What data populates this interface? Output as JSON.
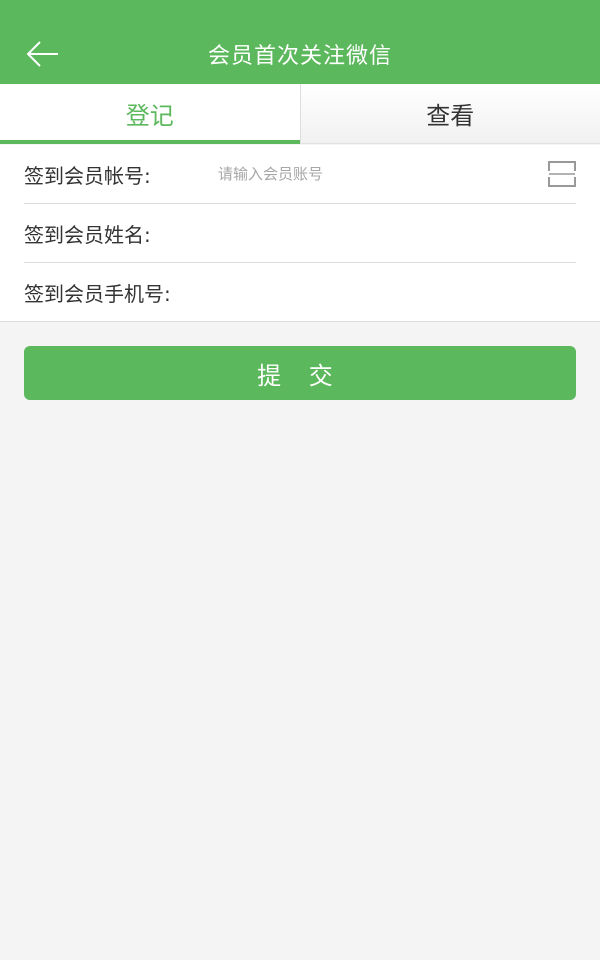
{
  "header": {
    "title": "会员首次关注微信",
    "back_icon": "arrow-left-icon"
  },
  "tabs": [
    {
      "label": "登记",
      "active": true
    },
    {
      "label": "查看",
      "active": false
    }
  ],
  "form": {
    "account": {
      "label": "签到会员帐号:",
      "placeholder": "请输入会员账号",
      "value": "",
      "scan_icon": "scan-icon"
    },
    "name": {
      "label": "签到会员姓名:",
      "value": ""
    },
    "phone": {
      "label": "签到会员手机号:",
      "value": ""
    }
  },
  "submit_label": "提 交",
  "colors": {
    "accent": "#5cb85c",
    "background": "#f4f4f4",
    "text": "#333333",
    "placeholder": "#a6a6a6"
  }
}
